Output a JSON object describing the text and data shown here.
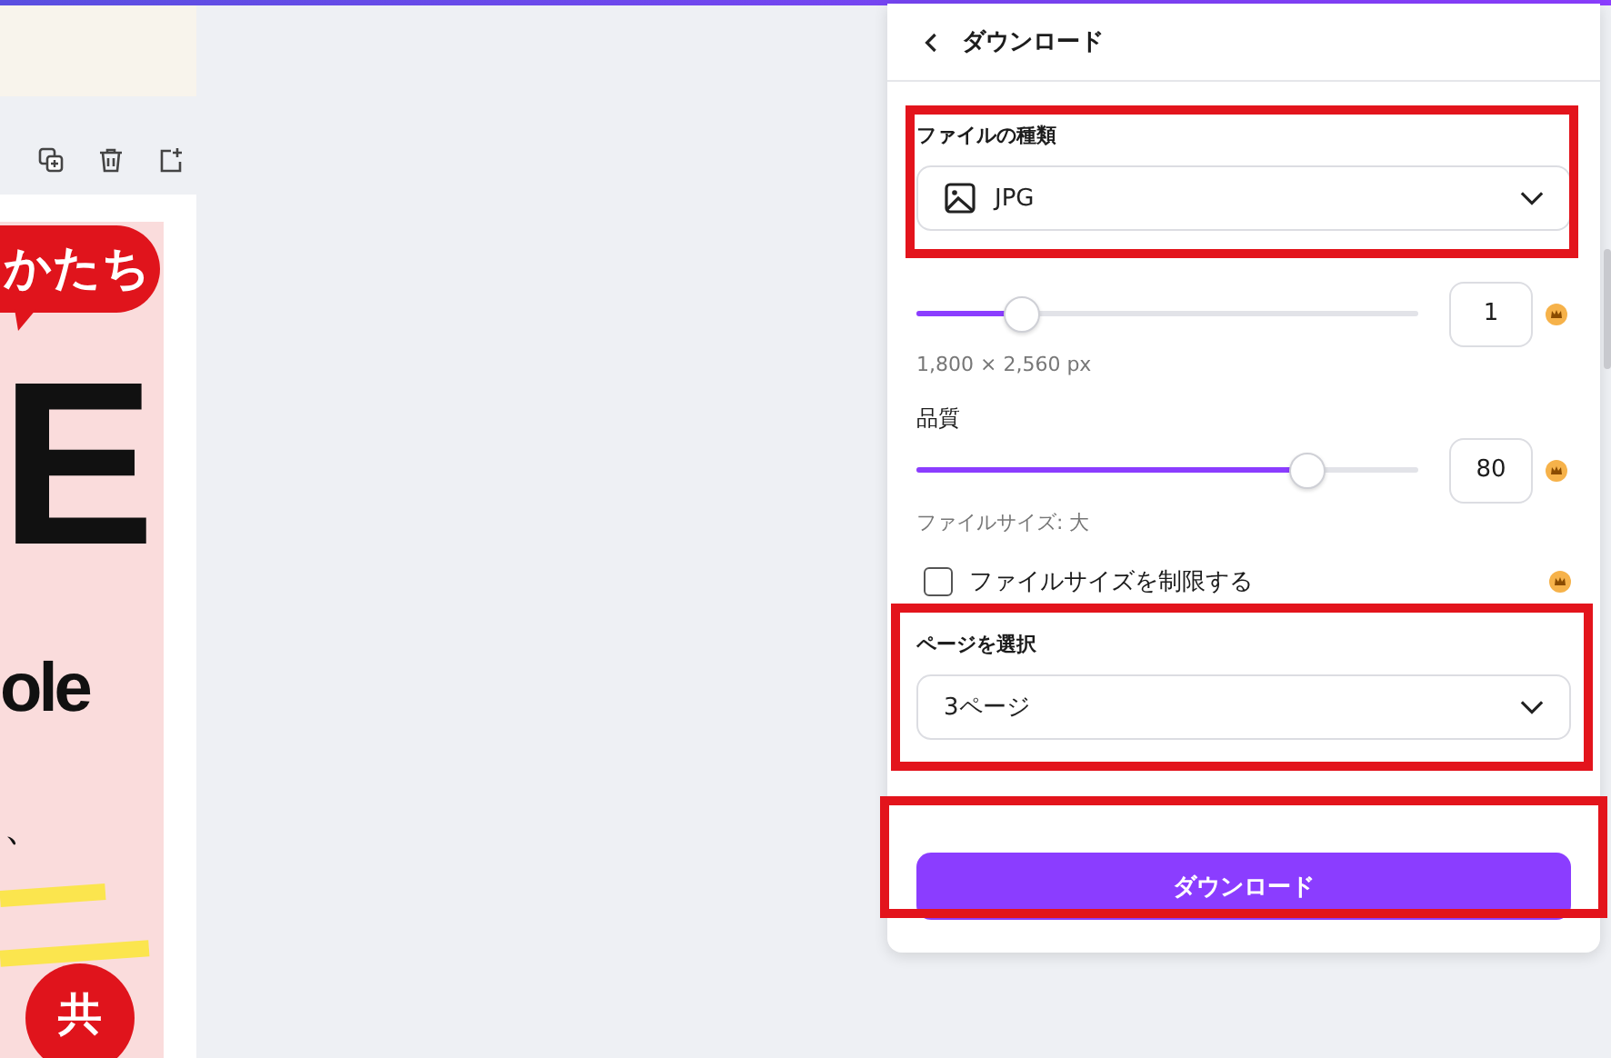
{
  "design": {
    "bubble": "かたち",
    "headline": "E",
    "subline": "ole",
    "mark": "、",
    "badge": "共"
  },
  "panel": {
    "title": "ダウンロード",
    "file_type": {
      "label": "ファイルの種類",
      "value": "JPG"
    },
    "size": {
      "level": 0.21,
      "value": "1",
      "dimensions": "1,800 × 2,560 px"
    },
    "quality": {
      "label": "品質",
      "level": 0.78,
      "value": "80",
      "file_size": "ファイルサイズ: 大"
    },
    "limit_file_size": {
      "label": "ファイルサイズを制限する",
      "checked": false
    },
    "pages": {
      "label": "ページを選択",
      "value": "3ページ"
    },
    "download_button": "ダウンロード"
  }
}
